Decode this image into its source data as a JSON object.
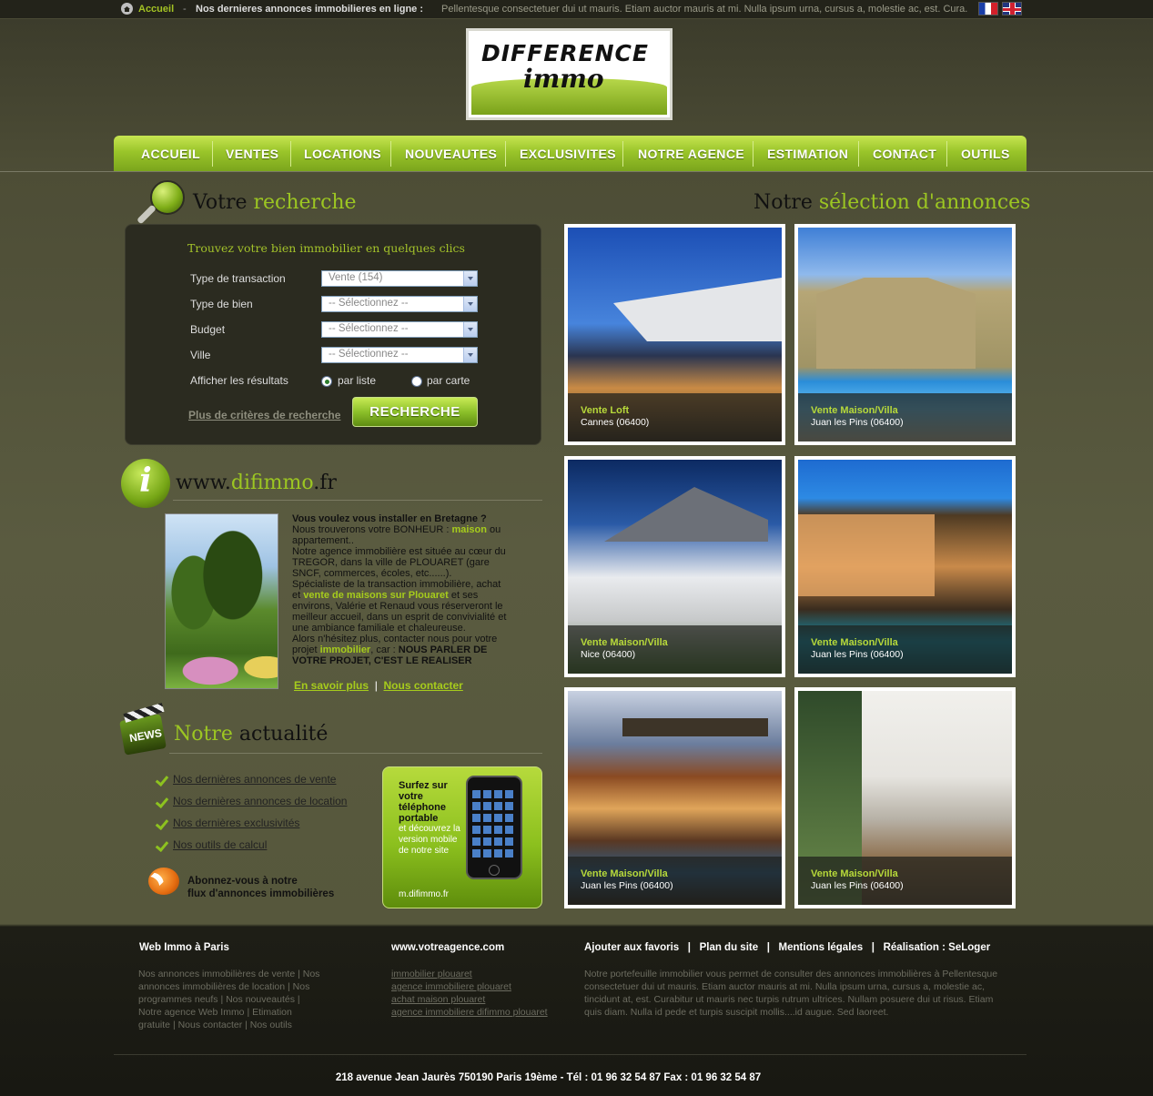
{
  "topbar": {
    "home_label": "Accueil",
    "separator": "-",
    "ticker_title": "Nos dernieres annonces immobilieres en ligne :",
    "ticker_text": "Pellentesque consectetuer dui ut mauris. Etiam auctor mauris at mi. Nulla ipsum urna, cursus a, molestie ac, est. Cura..."
  },
  "logo": {
    "line1": "DIFFERENCE",
    "line2": "immo"
  },
  "nav": {
    "items": [
      "ACCUEIL",
      "VENTES",
      "LOCATIONS",
      "NOUVEAUTES",
      "EXCLUSIVITES",
      "NOTRE AGENCE",
      "ESTIMATION",
      "CONTACT",
      "OUTILS"
    ]
  },
  "search": {
    "title_a": "Votre",
    "title_b": "recherche",
    "tagline": "Trouvez votre bien immobilier en quelques clics",
    "fields": [
      {
        "label": "Type de transaction",
        "value": "Vente (154)"
      },
      {
        "label": "Type de bien",
        "value": "-- Sélectionnez --"
      },
      {
        "label": "Budget",
        "value": "-- Sélectionnez --"
      },
      {
        "label": "Ville",
        "value": "-- Sélectionnez --"
      }
    ],
    "display_label": "Afficher les résultats",
    "radio_list": "par liste",
    "radio_map": "par carte",
    "more_criteria": "Plus de critères de recherche",
    "button": "RECHERCHE"
  },
  "info": {
    "title_a": "www.",
    "title_b": "difimmo",
    "title_c": ".fr",
    "heading": "Vous voulez vous installer en Bretagne ?",
    "p1a": "Nous trouverons votre BONHEUR :",
    "p1b": "maison",
    "p1c": "ou appartement..",
    "p2": "Notre agence immobilière est située au cœur du TREGOR, dans la ville de PLOUARET (gare SNCF, commerces, écoles, etc......).",
    "p3a": "Spécialiste de la transaction immobilière, achat et",
    "p3b": "vente de maisons sur Plouaret",
    "p3c": "et ses environs, Valérie et Renaud vous réserveront le meilleur accueil, dans un esprit de convivialité et une ambiance familiale et chaleureuse.",
    "p4a": "Alors n'hésitez plus, contacter nous pour votre projet",
    "p4b": "immobilier",
    "p4c": ", car :",
    "p4d": "NOUS PARLER DE VOTRE PROJET, C'EST LE REALISER",
    "link_more": "En savoir plus",
    "link_sep": "|",
    "link_contact": "Nous contacter"
  },
  "news": {
    "icon_label": "NEWS",
    "title_a": "Notre",
    "title_b": "actualité",
    "items": [
      "Nos dernières annonces de vente",
      "Nos dernières annonces de location",
      "Nos dernières exclusivités",
      "Nos outils de calcul"
    ],
    "rss_line1": "Abonnez-vous à notre",
    "rss_line2": "flux d'annonces immobilières"
  },
  "mobile": {
    "title": "Surfez sur votre téléphone portable",
    "text": "et découvrez la version mobile de notre site",
    "url": "m.difimmo.fr"
  },
  "selection": {
    "title_a": "Notre",
    "title_b": "sélection d'annonces",
    "listings": [
      {
        "type": "Vente Loft",
        "city": "Cannes (06400)"
      },
      {
        "type": "Vente Maison/Villa",
        "city": "Juan les Pins (06400)"
      },
      {
        "type": "Vente Maison/Villa",
        "city": "Nice (06400)"
      },
      {
        "type": "Vente Maison/Villa",
        "city": "Juan les Pins (06400)"
      },
      {
        "type": "Vente Maison/Villa",
        "city": "Juan les Pins (06400)"
      },
      {
        "type": "Vente Maison/Villa",
        "city": "Juan les Pins (06400)"
      }
    ]
  },
  "footer": {
    "col1_title": "Web Immo à Paris",
    "col1_text": "Nos annonces immobilières de vente | Nos annonces immobilières de location | Nos programmes neufs | Nos nouveautés | Notre agence Web Immo | Etimation gratuite | Nous contacter | Nos outils",
    "col2_title": "www.votreagence.com",
    "col2_links": [
      "immobilier plouaret",
      "agence immobiliere plouaret",
      "achat maison plouaret",
      "agence immobiliere difimmo plouaret"
    ],
    "col3_links": [
      "Ajouter aux favoris",
      "Plan du site",
      "Mentions légales",
      "Réalisation : SeLoger"
    ],
    "col3_sep": "|",
    "col3_text": "Notre portefeuille immobilier vous permet de consulter des annonces immobilières à Pellentesque consectetuer dui ut mauris. Etiam auctor mauris at mi. Nulla ipsum urna, cursus a, molestie ac, tincidunt at, est. Curabitur ut mauris nec turpis rutrum ultrices. Nullam posuere dui ut risus. Etiam quis diam. Nulla id pede et turpis suscipit mollis....id augue. Sed laoreet.",
    "address": "218 avenue Jean Jaurès 750190 Paris 19ème -  Tél : 01 96 32 54 87  Fax : 01 96 32 54 87"
  },
  "colors": {
    "accent": "#9cc622",
    "nav_green": "#8fc02a",
    "dark_box": "#2b2b20"
  }
}
